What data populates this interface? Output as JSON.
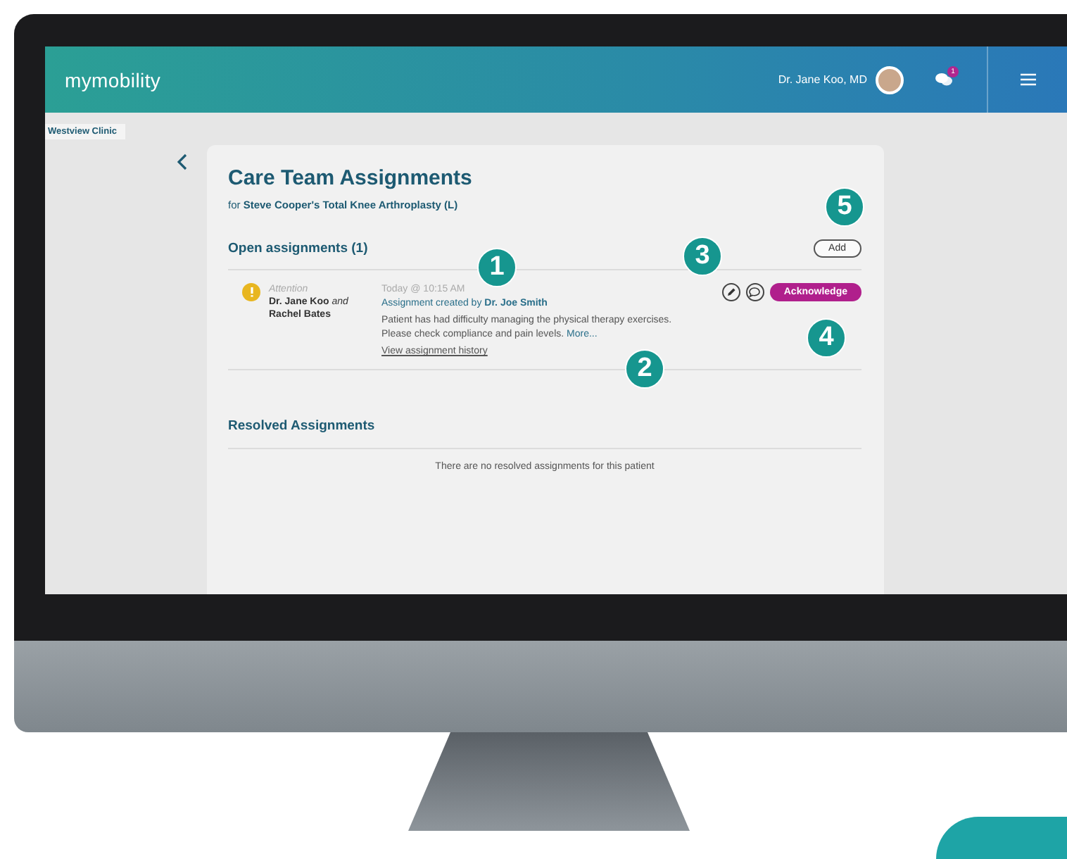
{
  "app": {
    "logo": "mymobility",
    "user_name": "Dr. Jane Koo, MD",
    "notification_count": "1",
    "clinic": "Westview Clinic"
  },
  "card": {
    "title": "Care Team Assignments",
    "subtitle": "for **Steve Cooper's Total Knee Arthroplasty (L)**",
    "open_heading": "Open assignments (1)",
    "add_button": "Add",
    "assignments": [
      {
        "attention_label": "Attention",
        "assignees": "**Dr. Jane Koo** *and* **Rachel Bates**",
        "time": "Today @ 10:15 AM",
        "created": "Assignment created by **Dr. Joe Smith**",
        "note": "Patient has had difficulty managing the physical therapy exercises. Please check compliance and pain levels.",
        "more_link": "More...",
        "history_link": "View assignment history",
        "action_button": "Acknowledge"
      }
    ],
    "resolved_heading": "Resolved Assignments",
    "resolved_empty": "There are no resolved assignments for this patient"
  },
  "callouts": [
    "1",
    "2",
    "3",
    "4",
    "5"
  ]
}
